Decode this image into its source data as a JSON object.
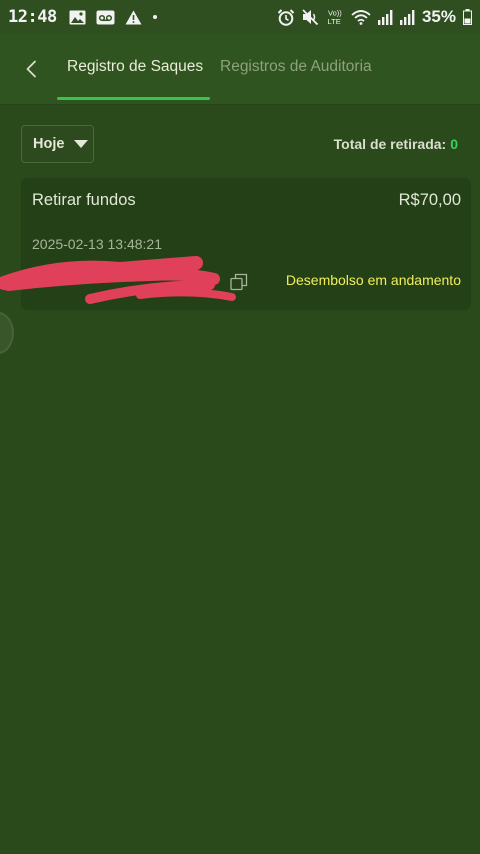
{
  "status_bar": {
    "time": "12:48",
    "battery": "35%",
    "icons": [
      "image-icon",
      "voicemail-icon",
      "warning-icon",
      "dot-icon",
      "alarm-icon",
      "mute-icon",
      "volte-icon",
      "wifi-icon",
      "signal-icon",
      "battery-icon"
    ],
    "volte_label": "Vo)) LTE"
  },
  "header": {
    "tabs": [
      {
        "label": "Registro de Saques",
        "active": true
      },
      {
        "label": "Registros de Auditoria",
        "active": false
      }
    ]
  },
  "filter": {
    "selected": "Hoje",
    "total_label": "Total de retirada:",
    "total_value": "0"
  },
  "records": [
    {
      "title": "Retirar fundos",
      "amount": "R$70,00",
      "datetime": "2025-02-13 13:48:21",
      "status": "Desembolso em andamento"
    }
  ],
  "colors": {
    "background": "#2b4a1c",
    "header": "#30541f",
    "card": "#234017",
    "active_tab_indicator": "#37c44a",
    "total_value": "#37d45a",
    "status_text": "#f2ee5a",
    "redaction": "#e0405a"
  }
}
